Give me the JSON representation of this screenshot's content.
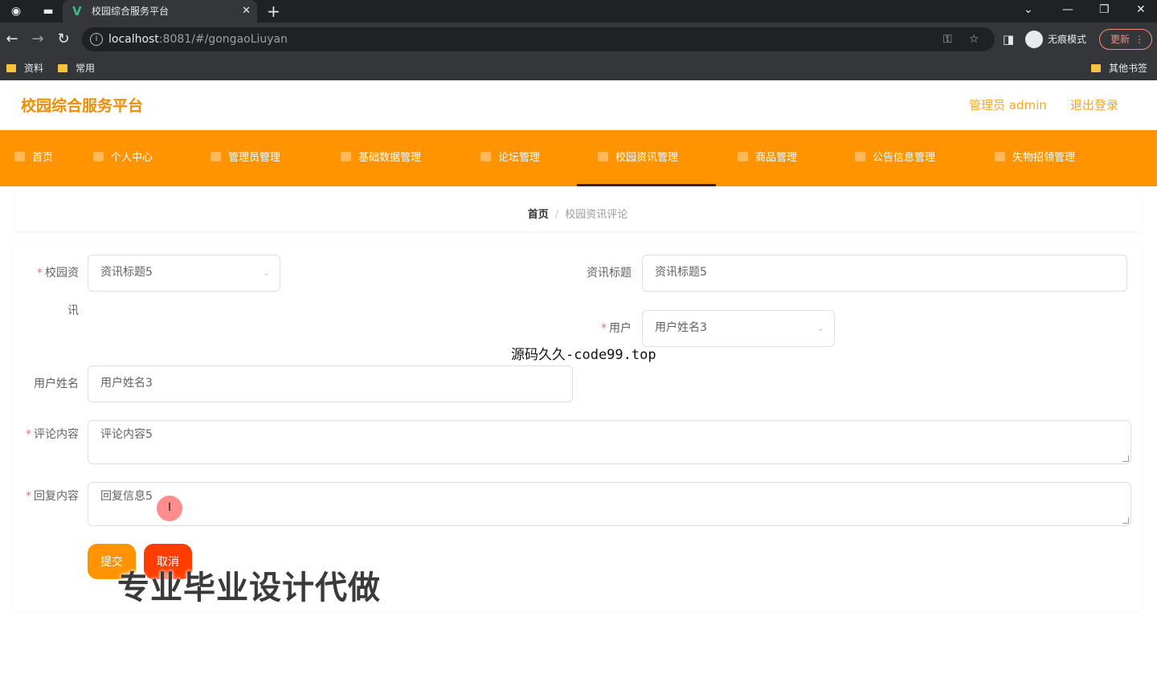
{
  "browser": {
    "tab_title": "校园综合服务平台",
    "url_host": "localhost",
    "url_rest": ":8081/#/gongaoLiuyan",
    "incognito_label": "无痕模式",
    "update_label": "更新",
    "bookmarks": [
      "资料",
      "常用"
    ],
    "other_bookmarks": "其他书签"
  },
  "header": {
    "title": "校园综合服务平台",
    "admin_label": "管理员 admin",
    "logout": "退出登录"
  },
  "menu": {
    "items": [
      "首页",
      "个人中心",
      "管理员管理",
      "基础数据管理",
      "论坛管理",
      "校园资讯管理",
      "商品管理",
      "公告信息管理",
      "失物招领管理"
    ],
    "active_index": 5
  },
  "breadcrumb": {
    "home": "首页",
    "separator": "/",
    "current": "校园资讯评论"
  },
  "form": {
    "news_label_1": "校园资",
    "news_label_2": "讯",
    "news_value": "资讯标题5",
    "news_title_label": "资讯标题",
    "news_title_value": "资讯标题5",
    "user_label": "用户",
    "user_value": "用户姓名3",
    "username_label": "用户姓名",
    "username_value": "用户姓名3",
    "comment_label": "评论内容",
    "comment_value": "评论内容5",
    "reply_label": "回复内容",
    "reply_value": "回复信息5",
    "submit_label": "提交",
    "cancel_label": "取消"
  },
  "overlays": {
    "source_text": "源码久久-code99.top",
    "promo_text": "专业毕业设计代做"
  },
  "colors": {
    "brand_orange": "#ff9400",
    "cancel_red": "#ff3d00",
    "title_orange": "#f28c00"
  }
}
